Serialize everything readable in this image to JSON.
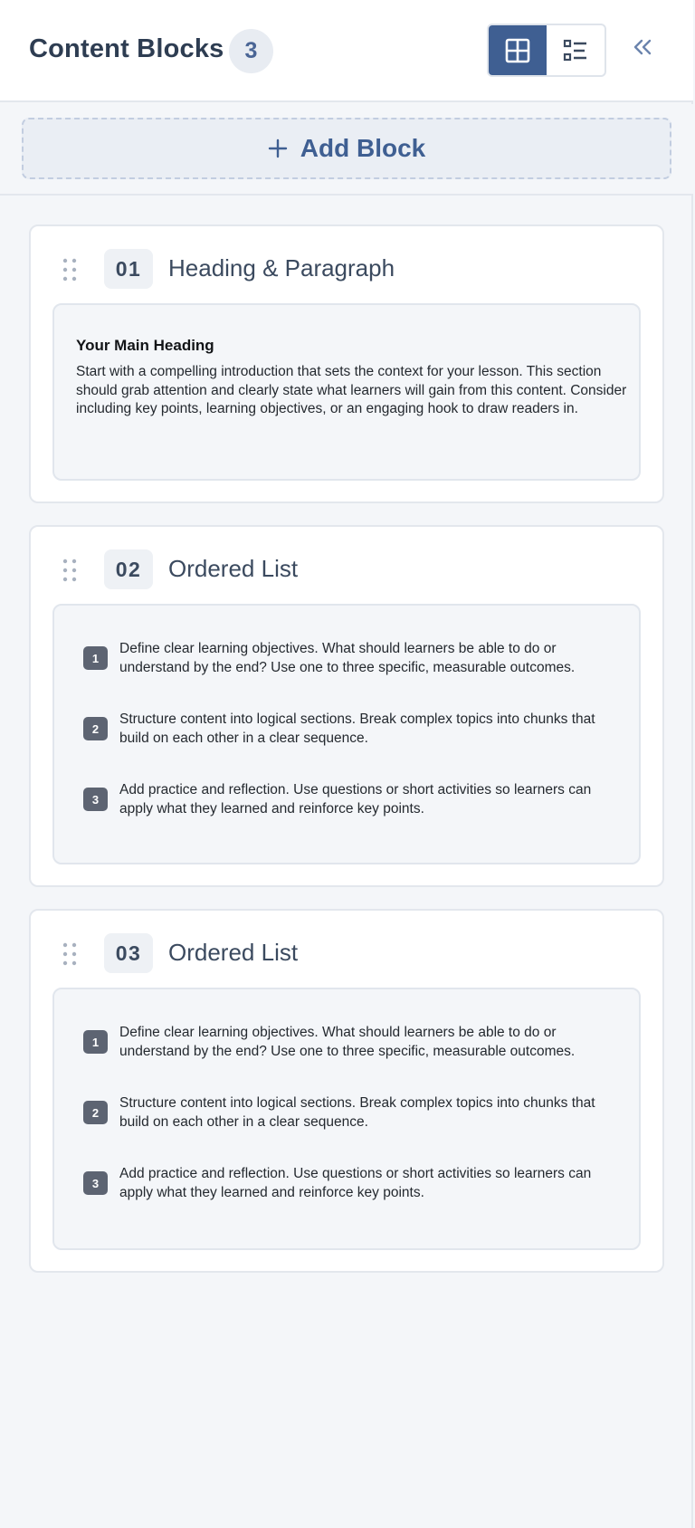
{
  "header": {
    "title": "Content Blocks",
    "count": "3"
  },
  "add_block": {
    "label": "Add Block"
  },
  "icons": {
    "grid_view": "grid-view-icon",
    "list_view": "list-view-icon",
    "collapse": "double-chevron-left-icon",
    "add": "plus-icon",
    "drag": "drag-handle-icon"
  },
  "colors": {
    "accent": "#3f5f92",
    "badge_bg": "#e8ecf2",
    "list_number_bg": "#5d6472"
  },
  "blocks": [
    {
      "number": "01",
      "type": "Heading & Paragraph",
      "heading": "Your Main Heading",
      "paragraph": "Start with a compelling introduction that sets the context for your lesson. This section should grab attention and clearly state what learners will gain from this content. Consider including key points, learning objectives, or an engaging hook to draw readers in."
    },
    {
      "number": "02",
      "type": "Ordered List",
      "items": [
        {
          "num": "1",
          "text": "Define clear learning objectives. What should learners be able to do or understand by the end? Use one to three specific, measurable outcomes."
        },
        {
          "num": "2",
          "text": "Structure content into logical sections. Break complex topics into chunks that build on each other in a clear sequence."
        },
        {
          "num": "3",
          "text": "Add practice and reflection. Use questions or short activities so learners can apply what they learned and reinforce key points."
        }
      ]
    },
    {
      "number": "03",
      "type": "Ordered List",
      "items": [
        {
          "num": "1",
          "text": "Define clear learning objectives. What should learners be able to do or understand by the end? Use one to three specific, measurable outcomes."
        },
        {
          "num": "2",
          "text": "Structure content into logical sections. Break complex topics into chunks that build on each other in a clear sequence."
        },
        {
          "num": "3",
          "text": "Add practice and reflection. Use questions or short activities so learners can apply what they learned and reinforce key points."
        }
      ]
    }
  ]
}
